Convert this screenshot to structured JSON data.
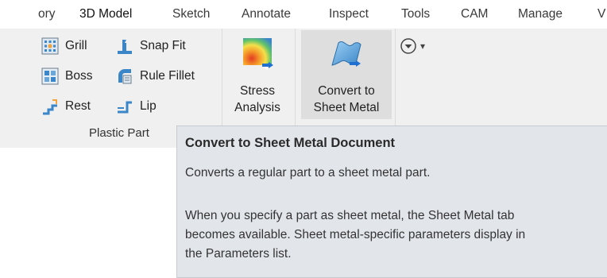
{
  "tabs": [
    {
      "label": "ory"
    },
    {
      "label": "3D Model",
      "active": true
    },
    {
      "label": "Sketch"
    },
    {
      "label": "Annotate"
    },
    {
      "label": "Inspect"
    },
    {
      "label": "Tools"
    },
    {
      "label": "CAM"
    },
    {
      "label": "Manage"
    },
    {
      "label": "V"
    }
  ],
  "plastic_part": {
    "label": "Plastic Part",
    "buttons": [
      {
        "label": "Grill",
        "icon": "grill-icon"
      },
      {
        "label": "Snap Fit",
        "icon": "snap-fit-icon"
      },
      {
        "label": "Boss",
        "icon": "boss-icon"
      },
      {
        "label": "Rule Fillet",
        "icon": "rule-fillet-icon"
      },
      {
        "label": "Rest",
        "icon": "rest-icon"
      },
      {
        "label": "Lip",
        "icon": "lip-icon"
      }
    ]
  },
  "stress": {
    "line1": "Stress",
    "line2": "Analysis",
    "icon": "stress-analysis-icon"
  },
  "convert": {
    "line1": "Convert to",
    "line2": "Sheet Metal",
    "icon": "convert-sheet-metal-icon"
  },
  "more": {
    "icon": "circle-chevron-down-icon",
    "caret": "▾"
  },
  "tooltip": {
    "title": "Convert to Sheet Metal Document",
    "summary": "Converts a regular part to a sheet metal part.",
    "detail_lines": [
      "When you specify a part as sheet metal, the Sheet Metal tab",
      "becomes available. Sheet metal-specific parameters display in",
      "the Parameters list."
    ]
  },
  "colors": {
    "ribbon_bg": "#f0f0f0",
    "tooltip_bg": "#e2e6ea",
    "icon_blue": "#3a86c8",
    "accent_blue": "#1f6fd1"
  }
}
